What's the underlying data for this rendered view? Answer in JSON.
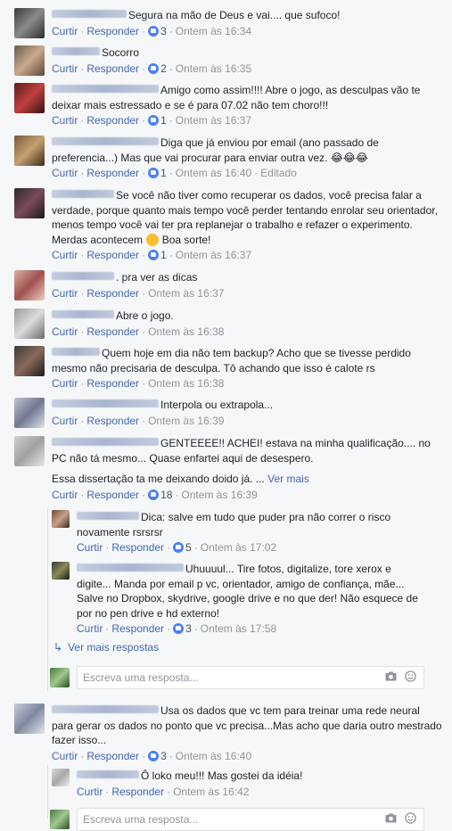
{
  "actions": {
    "curtir": "Curtir",
    "responder": "Responder"
  },
  "comments": [
    {
      "text": "Segura na mão de Deus e vai.... que sufoco!",
      "likes": "3",
      "time": "Ontem às 16:34"
    },
    {
      "text": "Socorro",
      "likes": "2",
      "time": "Ontem às 16:35"
    },
    {
      "text": "Amigo como assim!!!! Abre o jogo, as desculpas vão te deixar mais estressado e se é para 07.02 não tem choro!!!",
      "likes": "1",
      "time": "Ontem às 16:37"
    },
    {
      "text": "Diga que já enviou por email (ano passado de preferencia...) Mas que vai procurar para enviar outra vez. 😂😂😂",
      "likes": "1",
      "time": "Ontem às 16:40",
      "edited": "Editado"
    },
    {
      "text": "Se você não tiver como recuperar os dados, você precisa falar a verdade, porque quanto mais tempo você perder tentando enrolar seu orientador, menos tempo você vai ter pra replanejar o trabalho e refazer o experimento. Merdas acontecem",
      "suffix": "Boa sorte!",
      "likes": "1",
      "time": "Ontem às 16:37"
    },
    {
      "text": ". pra ver as dicas",
      "time": "Ontem às 16:37"
    },
    {
      "text": "Abre o jogo.",
      "time": "Ontem às 16:38"
    },
    {
      "text": "Quem hoje em dia não tem backup? Acho que se tivesse perdido mesmo não precisaria de desculpa. Tô achando que isso é calote rs",
      "time": "Ontem às 16:38"
    },
    {
      "text": "Interpola ou extrapola...",
      "time": "Ontem às 16:39"
    },
    {
      "text": "GENTEEEE!! ACHEI! estava na minha qualificação.... no PC não tá mesmo... Quase enfartei aqui de desespero.",
      "text2": "Essa dissertação ta me deixando doido já. ...",
      "see_more": "Ver mais",
      "likes": "18",
      "time": "Ontem às 16:39"
    },
    {
      "text": "Usa os dados que vc tem para treinar uma rede neural para gerar os dados no ponto que vc precisa...Mas acho que daria outro mestrado fazer isso...",
      "likes": "3",
      "time": "Ontem às 16:40"
    }
  ],
  "replies": [
    {
      "text": "Dica: salve em tudo que puder pra não correr o risco novamente rsrsrsr",
      "likes": "5",
      "time": "Ontem às 17:02"
    },
    {
      "text": "Uhuuuul... Tire fotos, digitalize, tore xerox e digite... Manda por email p vc, orientador, amigo de confiança, mãe... Salve no Dropbox, skydrive, google drive e no que der! Não esquece de por no pen drive e hd externo!",
      "likes": "3",
      "time": "Ontem às 17:58"
    },
    {
      "text": "Ô loko meu!!! Mas gostei da idéia!",
      "time": "Ontem às 16:42"
    }
  ],
  "more_replies": "Ver mais respostas",
  "reply_placeholder": "Escreva uma resposta...",
  "colors": {
    "link": "#4267b2",
    "meta": "#90949c",
    "like": "#4a80f5"
  }
}
